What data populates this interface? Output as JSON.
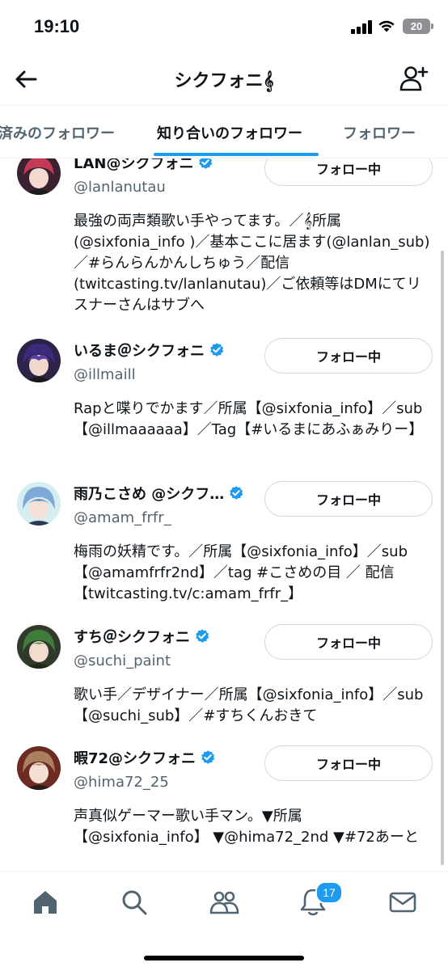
{
  "status": {
    "time": "19:10",
    "battery": "20"
  },
  "header": {
    "title": "シクフォニ𝄞"
  },
  "tabs": {
    "left": "済みのフォロワー",
    "middle": "知り合いのフォロワー",
    "right": "フォロワー"
  },
  "users": [
    {
      "name": "LAN@シクフォニ",
      "handle": "@lanlanutau",
      "bio": "最強の両声類歌い手やってます。／𝄞所属(@sixfonia_info )／基本ここに居ます(@lanlan_sub)／#らんらんかんしちゅう／配信(twitcasting.tv/lanlanutau)／ご依頼等はDMにてリスナーさんはサブへ",
      "button": "フォロー中"
    },
    {
      "name": "いるま＠シクフォニ",
      "handle": "@illmaill",
      "bio": "Rapと喋りでかます／所属【@sixfonia_info】／sub【@illmaaaaaa】／Tag【#いるまにあふぁみりー】",
      "button": "フォロー中"
    },
    {
      "name": "雨乃こさめ @シクフ…",
      "handle": "@amam_frfr_",
      "bio": "梅雨の妖精です。／所属【@sixfonia_info】／sub【@amamfrfr2nd】／tag #こさめの目 ／ 配信【twitcasting.tv/c:amam_frfr_】",
      "button": "フォロー中"
    },
    {
      "name": "すち＠シクフォニ",
      "handle": "@suchi_paint",
      "bio": "歌い手／デザイナー／所属【@sixfonia_info】／sub【@suchi_sub】／#すちくんおきて",
      "button": "フォロー中"
    },
    {
      "name": "暇72@シクフォニ",
      "handle": "@hima72_25",
      "bio": "声真似ゲーマー歌い手マン。▼所属【@sixfonia_info】 ▼@hima72_2nd ▼#72あーと",
      "button": "フォロー中"
    }
  ],
  "nav": {
    "notifications_badge": "17"
  },
  "colors": {
    "accent": "#1d9bf0",
    "muted": "#536471"
  }
}
